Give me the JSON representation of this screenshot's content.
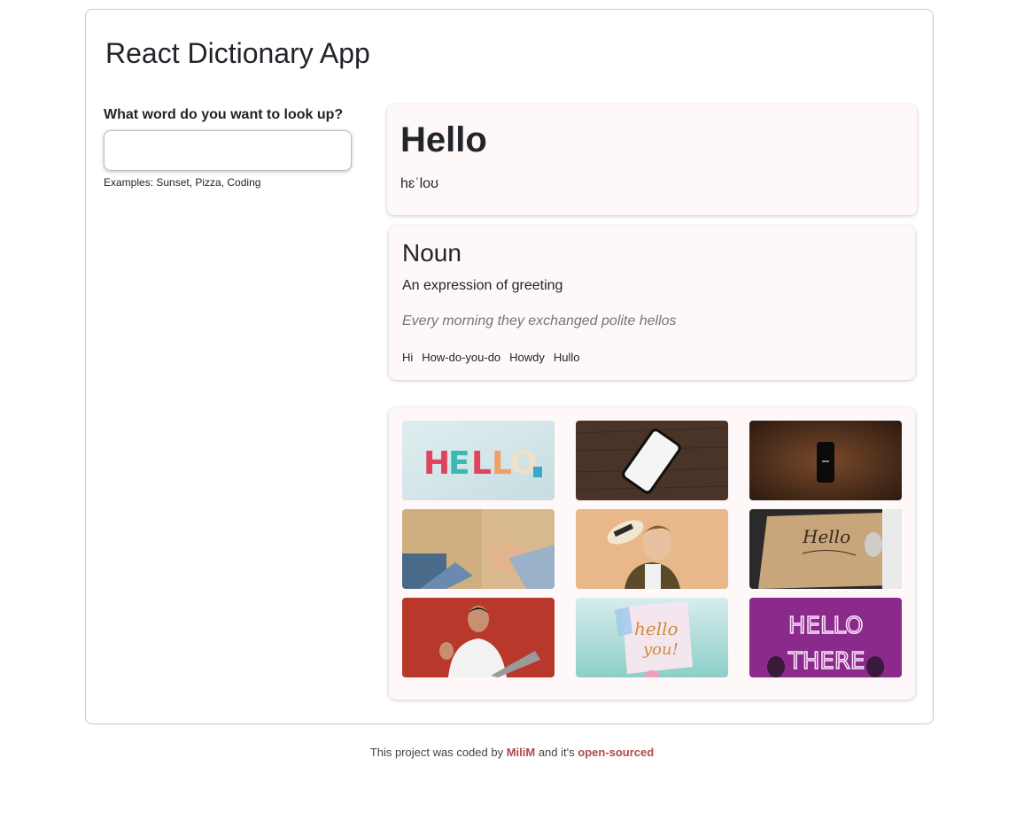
{
  "app": {
    "title": "React Dictionary App"
  },
  "search": {
    "label": "What word do you want to look up?",
    "value": "",
    "placeholder": "",
    "hint": "Examples: Sunset, Pizza, Coding"
  },
  "word": {
    "text": "Hello",
    "phonetic": "hɛˈloʊ"
  },
  "meaning": {
    "part_of_speech": "Noun",
    "definition": "An expression of greeting",
    "example": "Every morning they exchanged polite hellos",
    "synonyms": [
      "Hi",
      "How-do-you-do",
      "Howdy",
      "Hullo"
    ]
  },
  "photos": [
    {
      "name": "photo-hello-letters",
      "description": "colorful clay letters spelling HELLO"
    },
    {
      "name": "photo-phone-on-wood",
      "description": "white smartphone on dark wood table"
    },
    {
      "name": "photo-black-phone-on-wood",
      "description": "black smartphone on wood table"
    },
    {
      "name": "photo-handshake",
      "description": "two people shaking hands"
    },
    {
      "name": "photo-man-with-hat",
      "description": "smiling man tipping a hat"
    },
    {
      "name": "photo-hello-calligraphy",
      "description": "hand writing Hello on kraft paper"
    },
    {
      "name": "photo-man-waving-laptop",
      "description": "man waving at laptop on red background"
    },
    {
      "name": "photo-hello-you-note",
      "description": "note reading hello you"
    },
    {
      "name": "photo-hello-there-neon",
      "description": "neon sign reading HELLO THERE"
    }
  ],
  "footer": {
    "prefix": "This project was coded by",
    "author": "MiliM",
    "middle": "and it's",
    "link": "open-sourced"
  },
  "colors": {
    "card_background": "#fff8f8",
    "link": "#b04a4a"
  }
}
